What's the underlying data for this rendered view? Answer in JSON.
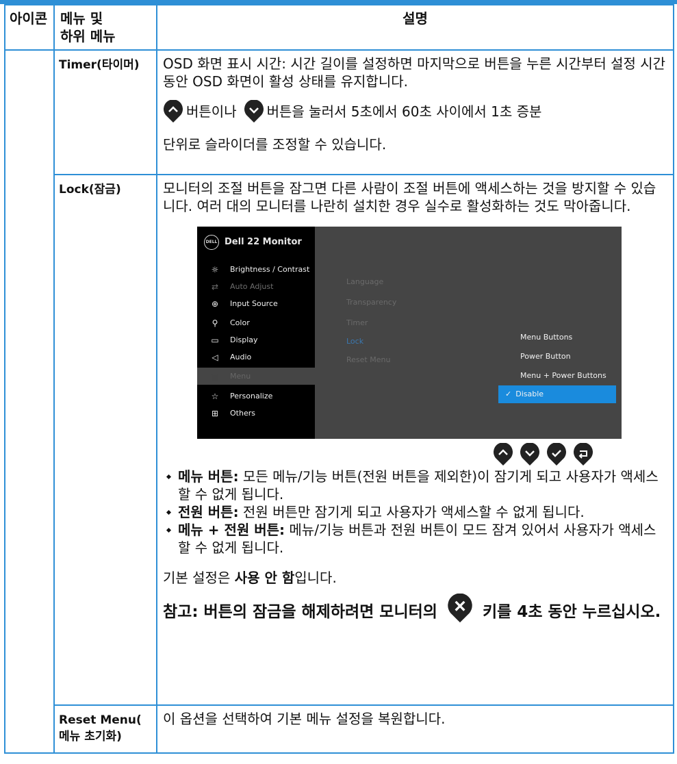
{
  "table": {
    "header": {
      "icon": "아이콘",
      "menu_line1": "메뉴 및",
      "menu_line2": "하위 메뉴",
      "description": "설명"
    },
    "rows": [
      {
        "menu": "Timer(타이머)",
        "text1": "OSD 화면 표시 시간: 시간 길이를 설정하면 마지막으로 버튼을 누른 시간부터 설정 시간 동안 OSD 화면이 활성 상태를 유지합니다.",
        "text2": "버튼이나",
        "text3": "버튼을 눌러서 5초에서 60초 사이에서 1초 증분",
        "text4": "단위로 슬라이더를 조정할 수 있습니다."
      },
      {
        "menu": "Lock(잠금)",
        "intro": "모니터의 조절 버튼을 잠그면 다른 사람이 조절 버튼에 액세스하는 것을 방지할 수 있습니다. 여러 대의 모니터를 나란히 설치한 경우 실수로 활성화하는 것도 막아줍니다.",
        "bullets": [
          {
            "term": "메뉴 버튼:",
            "text": " 모든 메뉴/기능 버튼(전원 버튼을 제외한)이 잠기게 되고 사용자가 액세스할 수 없게 됩니다."
          },
          {
            "term": "전원 버튼:",
            "text": " 전원 버튼만 잠기게 되고 사용자가 액세스할 수 없게 됩니다."
          },
          {
            "term": "메뉴 + 전원 버튼:",
            "text": " 메뉴/기능 버튼과 전원 버튼이 모드 잠겨 있어서 사용자가 액세스할 수 없게 됩니다."
          }
        ],
        "default_prefix": "기본 설정은 ",
        "default_value": "사용 안 함",
        "default_suffix": "입니다.",
        "note_part1": "참고: 버튼의 잠금을 해제하려면 모니터의",
        "note_part2": "키를 4초 동안 누르십시오."
      },
      {
        "menu_line1": "Reset Menu(",
        "menu_line2": "메뉴 초기화)",
        "text": "이 옵션을 선택하여 기본 메뉴 설정을 복원합니다."
      }
    ]
  },
  "osd": {
    "title": "Dell 22 Monitor",
    "logo": "DELL",
    "menu": [
      {
        "label": "Brightness / Contrast",
        "icon": "brightness-icon",
        "glyph": "☼",
        "state": "normal"
      },
      {
        "label": "Auto Adjust",
        "icon": "auto-adjust-icon",
        "glyph": "⇄",
        "state": "dim"
      },
      {
        "label": "Input Source",
        "icon": "input-source-icon",
        "glyph": "⊕",
        "state": "normal"
      },
      {
        "label": "Color",
        "icon": "color-icon",
        "glyph": "⚲",
        "state": "normal"
      },
      {
        "label": "Display",
        "icon": "display-icon",
        "glyph": "▭",
        "state": "normal"
      },
      {
        "label": "Audio",
        "icon": "audio-icon",
        "glyph": "◁",
        "state": "normal"
      },
      {
        "label": "Menu",
        "icon": "menu-icon",
        "glyph": "▤",
        "state": "selected"
      },
      {
        "label": "Personalize",
        "icon": "star-icon",
        "glyph": "☆",
        "state": "normal"
      },
      {
        "label": "Others",
        "icon": "others-icon",
        "glyph": "⊞",
        "state": "normal"
      }
    ],
    "submenu": [
      {
        "label": "Language",
        "selected": false
      },
      {
        "label": "Transparency",
        "selected": false
      },
      {
        "label": "Timer",
        "selected": false
      },
      {
        "label": "Lock",
        "selected": true
      },
      {
        "label": "Reset Menu",
        "selected": false
      }
    ],
    "options": [
      {
        "label": "Menu Buttons",
        "selected": false
      },
      {
        "label": "Power Button",
        "selected": false
      },
      {
        "label": "Menu + Power Buttons",
        "selected": false
      },
      {
        "label": "Disable",
        "selected": true
      }
    ],
    "buttons": [
      "up-button-icon",
      "down-button-icon",
      "check-button-icon",
      "back-button-icon"
    ]
  },
  "colors": {
    "border": "#2e8fd6",
    "osd_bg": "#454545",
    "osd_left": "#000000",
    "osd_selected": "#1a8bdd"
  }
}
